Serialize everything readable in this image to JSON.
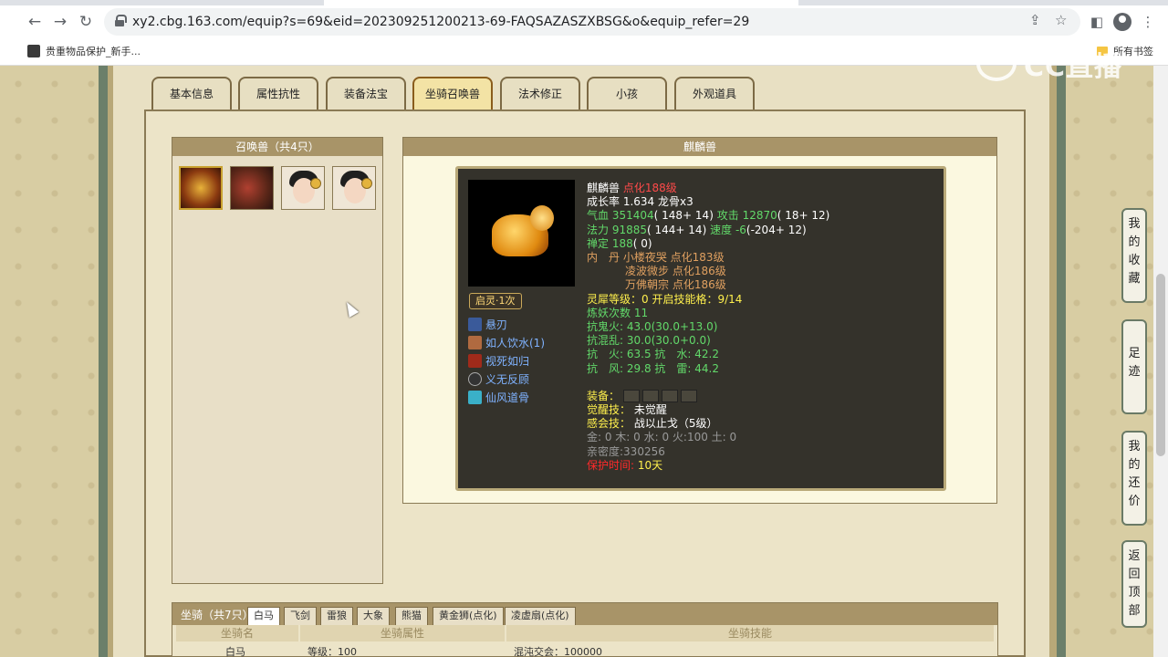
{
  "browser": {
    "url": "xy2.cbg.163.com/equip?s=69&eid=202309251200213-69-FAQSAZASZXBSG&o&equip_refer=29",
    "bookmark_item": "贵重物品保护_新手...",
    "bookmarks_all": "所有书签"
  },
  "watermark": "CC直播",
  "tabs": [
    "基本信息",
    "属性抗性",
    "装备法宝",
    "坐骑召唤兽",
    "法术修正",
    "小孩",
    "外观道具"
  ],
  "left_panel": {
    "title": "召唤兽（共4只）"
  },
  "right_panel": {
    "title": "麒麟兽"
  },
  "pet": {
    "name": "麒麟兽",
    "level": "点化188级",
    "growth": "成长率 1.634 龙骨x3",
    "hp_label": "气血",
    "hp_value": "351404",
    "hp_extra": "( 148+ 14)",
    "atk_label": "攻击",
    "atk_value": "12870",
    "atk_extra": "( 18+ 12)",
    "mp_label": "法力",
    "mp_value": "91885",
    "mp_extra": "( 144+ 14)",
    "spd_label": "速度",
    "spd_value": "-6",
    "spd_extra": "(-204+ 12)",
    "focus_label": "禅定",
    "focus_value": "188",
    "focus_extra": "( 0)",
    "dan_label": "内　丹",
    "dan1": "小楼夜哭 点化183级",
    "dan2": "凌波微步 点化186级",
    "dan3": "万佛朝宗 点化186级",
    "spirit": "灵犀等级：0 开启技能格：9/14",
    "refine": "炼妖次数 11",
    "resist1": "抗鬼火: 43.0(30.0+13.0)",
    "resist2": "抗混乱: 30.0(30.0+0.0)",
    "resist3": "抗　火: 63.5 抗　水: 42.2",
    "resist4": "抗　风: 29.8 抗　雷: 44.2",
    "equip_label": "装备：",
    "awaken_label": "觉醒技：",
    "awaken_value": "未觉醒",
    "sense_label": "感会技：",
    "sense_value": "战以止戈（5级）",
    "elements": "金: 0 木: 0 水: 0 火:100 土: 0",
    "intimacy": "亲密度:330256",
    "protect_label": "保护时间:",
    "protect_value": "10天",
    "qiling": "启灵·1次",
    "skills": [
      "悬刃",
      "如人饮水(1)",
      "视死如归",
      "义无反顾",
      "仙风道骨"
    ]
  },
  "mount": {
    "title": "坐骑（共7只）",
    "tabs": [
      "白马",
      "飞剑",
      "雷狼",
      "大象",
      "熊猫",
      "黄金狮(点化)",
      "凌虚扇(点化)"
    ],
    "headers": [
      "坐骑名",
      "坐骑属性",
      "坐骑技能"
    ],
    "row": [
      "白马",
      "等级：100",
      "混沌交会：100000"
    ]
  },
  "float_buttons": [
    "我的收藏",
    "足迹",
    "我的还价",
    "返回顶部"
  ]
}
